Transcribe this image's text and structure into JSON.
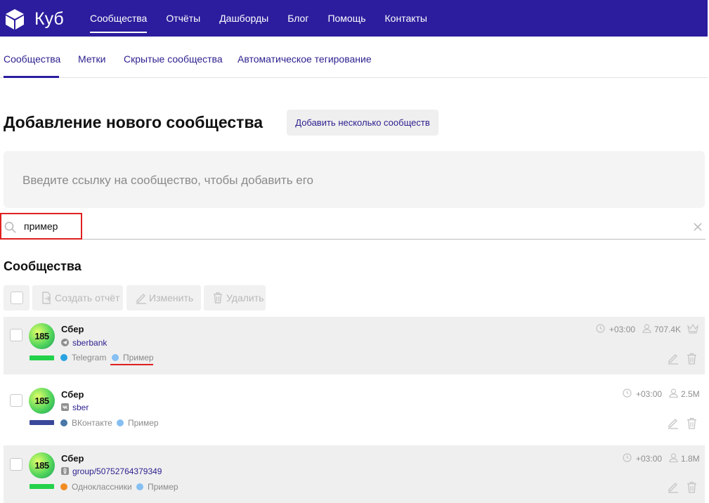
{
  "app": {
    "logo_text": "Куб"
  },
  "nav": {
    "items": [
      {
        "label": "Сообщества",
        "active": true
      },
      {
        "label": "Отчёты"
      },
      {
        "label": "Дашборды"
      },
      {
        "label": "Блог"
      },
      {
        "label": "Помощь"
      },
      {
        "label": "Контакты"
      }
    ]
  },
  "tabs": [
    {
      "label": "Сообщества",
      "active": true
    },
    {
      "label": "Метки"
    },
    {
      "label": "Скрытые сообщества"
    },
    {
      "label": "Автоматическое тегирование"
    }
  ],
  "page": {
    "title": "Добавление нового сообщества",
    "add_multiple_label": "Добавить несколько сообществ",
    "link_placeholder": "Введите ссылку на сообщество, чтобы добавить его"
  },
  "search": {
    "value": "пример"
  },
  "communities": {
    "title": "Сообщества",
    "toolbar": {
      "create_report": "Создать отчёт",
      "edit": "Изменить",
      "delete": "Удалить"
    },
    "rows": [
      {
        "name": "Сбер",
        "avatar_text": "185",
        "platform_icon": "telegram-icon",
        "handle": "sberbank",
        "platform": "Telegram",
        "platform_color": "#2aa3e0",
        "bar_color": "#24d14a",
        "tag": "Пример",
        "tag_color": "#86bff2",
        "timezone": "+03:00",
        "subscribers": "707.4K",
        "crown": true
      },
      {
        "name": "Сбер",
        "avatar_text": "185",
        "platform_icon": "vk-icon",
        "handle": "sber",
        "platform": "ВКонтакте",
        "platform_color": "#4a76a8",
        "bar_color": "#39489a",
        "tag": "Пример",
        "tag_color": "#86bff2",
        "timezone": "+03:00",
        "subscribers": "2.5M",
        "crown": false
      },
      {
        "name": "Сбер",
        "avatar_text": "185",
        "platform_icon": "odnoklassniki-icon",
        "handle": "group/50752764379349",
        "platform": "Одноклассники",
        "platform_color": "#f28c22",
        "bar_color": "#24d14a",
        "tag": "Пример",
        "tag_color": "#86bff2",
        "timezone": "+03:00",
        "subscribers": "1.8M",
        "crown": false
      }
    ]
  }
}
